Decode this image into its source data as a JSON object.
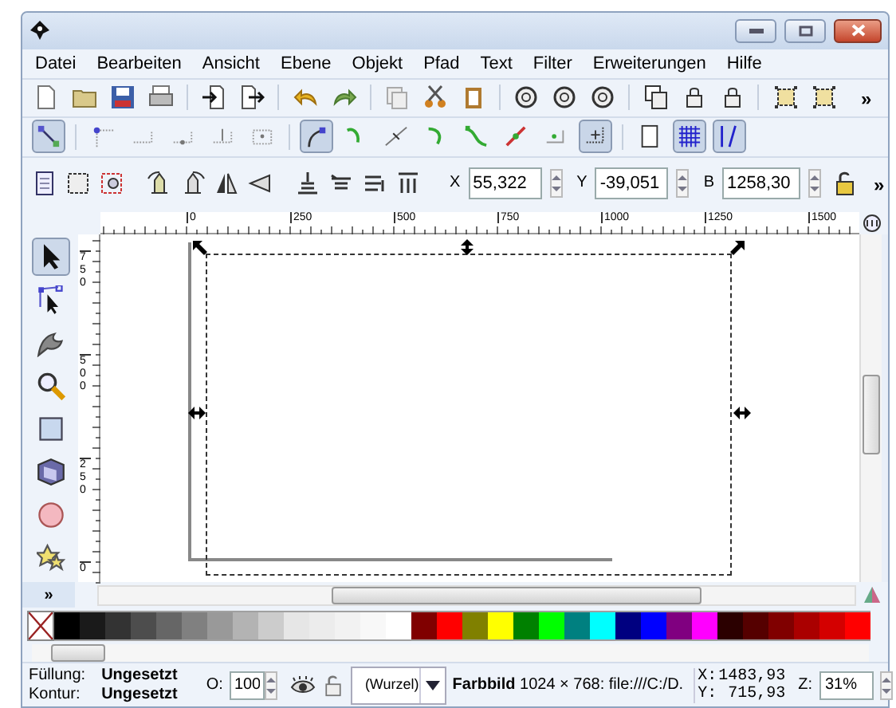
{
  "menu": [
    {
      "label": "Datei"
    },
    {
      "label": "Bearbeiten"
    },
    {
      "label": "Ansicht"
    },
    {
      "label": "Ebene"
    },
    {
      "label": "Objekt"
    },
    {
      "label": "Pfad"
    },
    {
      "label": "Text"
    },
    {
      "label": "Filter"
    },
    {
      "label": "Erweiterungen"
    },
    {
      "label": "Hilfe"
    }
  ],
  "commands_toolbar": {
    "overflow": "»"
  },
  "snap_toolbar": {
    "buttons": [
      {
        "on": true
      },
      {
        "on": false
      },
      {
        "on": false
      },
      {
        "on": false
      },
      {
        "on": false
      },
      {
        "on": false
      },
      {
        "on": true
      },
      {
        "on": false
      },
      {
        "on": false
      },
      {
        "on": false
      },
      {
        "on": false
      },
      {
        "on": false
      },
      {
        "on": false
      },
      {
        "on": true
      },
      {
        "on": false
      },
      {
        "on": true
      },
      {
        "on": true
      }
    ]
  },
  "tool_controls": {
    "fields": [
      {
        "label": "X",
        "value": "55,322"
      },
      {
        "label": "Y",
        "value": "-39,051"
      },
      {
        "label": "B",
        "value": "1258,30"
      }
    ],
    "overflow": "»"
  },
  "horizontal_ruler": [
    "0",
    "250",
    "500",
    "750",
    "1000",
    "1250",
    "1500"
  ],
  "vertical_ruler": [
    "750",
    "500",
    "250",
    "0"
  ],
  "toolbox": [
    {
      "selected": true
    },
    {
      "selected": false
    },
    {
      "selected": false
    },
    {
      "selected": false
    },
    {
      "selected": false
    },
    {
      "selected": false
    },
    {
      "selected": false
    },
    {
      "selected": false
    }
  ],
  "toolbox_overflow": "»",
  "palette": [
    {
      "kind": "none"
    },
    {
      "kind": "swatch",
      "color": "#000000"
    },
    {
      "kind": "swatch",
      "color": "#1a1a1a"
    },
    {
      "kind": "swatch",
      "color": "#333333"
    },
    {
      "kind": "swatch",
      "color": "#4d4d4d"
    },
    {
      "kind": "swatch",
      "color": "#666666"
    },
    {
      "kind": "swatch",
      "color": "#808080"
    },
    {
      "kind": "swatch",
      "color": "#999999"
    },
    {
      "kind": "swatch",
      "color": "#b3b3b3"
    },
    {
      "kind": "swatch",
      "color": "#cccccc"
    },
    {
      "kind": "swatch",
      "color": "#e6e6e6"
    },
    {
      "kind": "swatch",
      "color": "#ececec"
    },
    {
      "kind": "swatch",
      "color": "#f2f2f2"
    },
    {
      "kind": "swatch",
      "color": "#f8f8f8"
    },
    {
      "kind": "swatch",
      "color": "#ffffff"
    },
    {
      "kind": "swatch",
      "color": "#800000"
    },
    {
      "kind": "swatch",
      "color": "#ff0000"
    },
    {
      "kind": "swatch",
      "color": "#808000"
    },
    {
      "kind": "swatch",
      "color": "#ffff00"
    },
    {
      "kind": "swatch",
      "color": "#008000"
    },
    {
      "kind": "swatch",
      "color": "#00ff00"
    },
    {
      "kind": "swatch",
      "color": "#008080"
    },
    {
      "kind": "swatch",
      "color": "#00ffff"
    },
    {
      "kind": "swatch",
      "color": "#000080"
    },
    {
      "kind": "swatch",
      "color": "#0000ff"
    },
    {
      "kind": "swatch",
      "color": "#800080"
    },
    {
      "kind": "swatch",
      "color": "#ff00ff"
    },
    {
      "kind": "swatch",
      "color": "#2b0000"
    },
    {
      "kind": "swatch",
      "color": "#550000"
    },
    {
      "kind": "swatch",
      "color": "#800000"
    },
    {
      "kind": "swatch",
      "color": "#aa0000"
    },
    {
      "kind": "swatch",
      "color": "#d40000"
    },
    {
      "kind": "swatch",
      "color": "#ff0000"
    }
  ],
  "status_bar": {
    "fill_label": "Füllung:",
    "fill_value": "Ungesetzt",
    "stroke_label": "Kontur:",
    "stroke_value": "Ungesetzt",
    "opacity_label": "O:",
    "opacity_value": "100",
    "layer": "(Wurzel)",
    "message": "**Farbbild** 1024 × 768: file:///C:/D.",
    "x_label": "X:",
    "x_value": "1483,93",
    "y_label": "Y:",
    "y_value": "715,93",
    "zoom_label": "Z:",
    "zoom_value": "31%"
  }
}
